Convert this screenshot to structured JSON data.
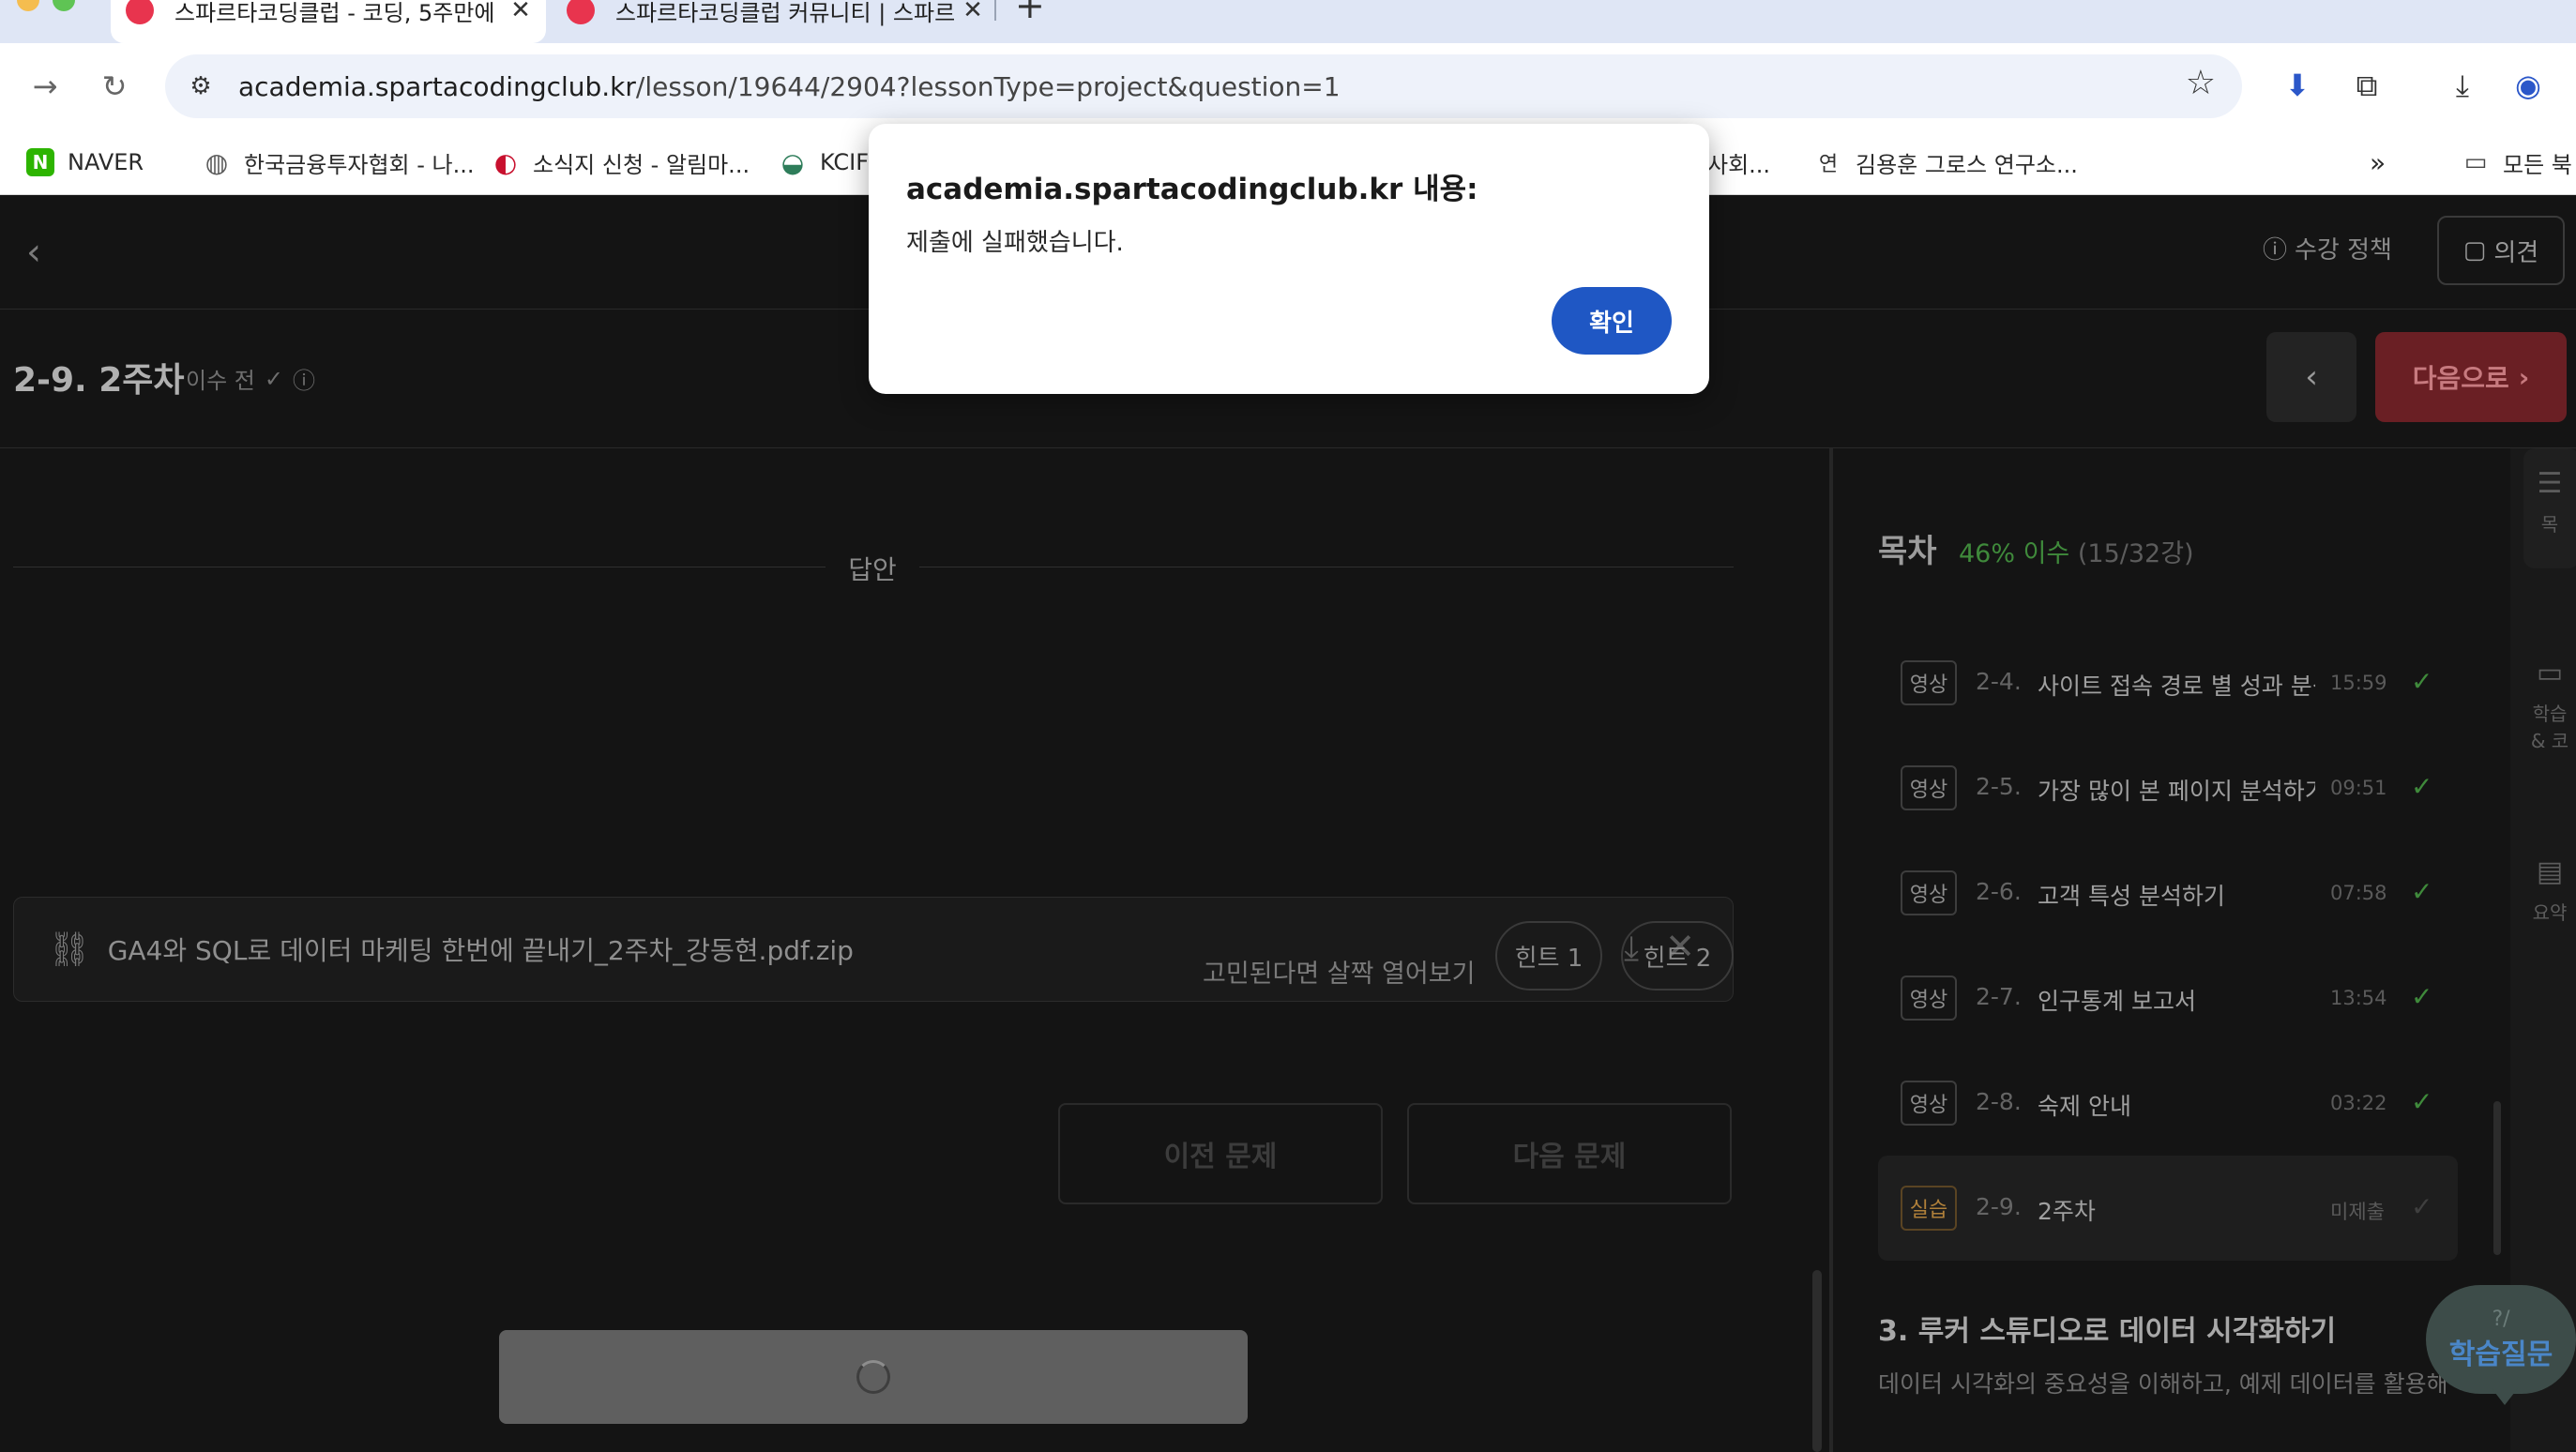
{
  "browser": {
    "tabs": [
      {
        "title": "스파르타코딩클럽 - 코딩, 5주만에",
        "close": "✕"
      },
      {
        "title": "스파르타코딩클럽 커뮤니티 | 스파르",
        "close": "✕"
      }
    ],
    "new_tab": "+",
    "url_host": "academia.spartacodingclub.kr",
    "url_path": "/lesson/19644/2904?lessonType=project&question=1",
    "bookmarks": [
      {
        "label": "NAVER",
        "icon": "naver-icon",
        "color": "#2db400",
        "glyph": "N"
      },
      {
        "label": "한국금융투자협회 - 나...",
        "icon": "globe-icon",
        "color": "#5a5a5a",
        "glyph": "◍"
      },
      {
        "label": "소식지 신청 - 알림마...",
        "icon": "korea-gov-icon",
        "color": "#c8102e",
        "glyph": "◐"
      },
      {
        "label": "KCIF",
        "icon": "kcif-icon",
        "color": "#2e7d5a",
        "glyph": "◒"
      },
      {
        "label": "사회...",
        "icon": "",
        "color": "",
        "glyph": ""
      },
      {
        "label": "김용훈 그로스 연구소...",
        "icon": "yeon-icon",
        "color": "#333333",
        "glyph": "연"
      }
    ],
    "bookmarks_more": "»",
    "all_bookmarks": "모든 북"
  },
  "header": {
    "policy": "수강 정책",
    "feedback": "의견"
  },
  "lesson": {
    "title": "2-9. 2주차",
    "status": "이수 전",
    "next": "다음으로"
  },
  "main": {
    "answer_label": "답안",
    "file_name": "GA4와 SQL로 데이터 마케팅 한번에 끝내기_2주차_강동현.pdf.zip",
    "hint_prompt": "고민된다면 살짝 열어보기",
    "hint1": "힌트 1",
    "hint2": "힌트 2",
    "prev_question": "이전 문제",
    "next_question": "다음 문제"
  },
  "toc": {
    "heading": "목차",
    "progress": "46% 이수",
    "count": "(15/32강)",
    "items": [
      {
        "tag": "영상",
        "num": "2-4.",
        "title": "사이트 접속 경로 별 성과 분석",
        "duration": "15:59",
        "check": "✓"
      },
      {
        "tag": "영상",
        "num": "2-5.",
        "title": "가장 많이 본 페이지 분석하기",
        "duration": "09:51",
        "check": "✓"
      },
      {
        "tag": "영상",
        "num": "2-6.",
        "title": "고객 특성 분석하기",
        "duration": "07:58",
        "check": "✓"
      },
      {
        "tag": "영상",
        "num": "2-7.",
        "title": "인구통계 보고서",
        "duration": "13:54",
        "check": "✓"
      },
      {
        "tag": "영상",
        "num": "2-8.",
        "title": "숙제 안내",
        "duration": "03:22",
        "check": "✓"
      },
      {
        "tag": "실습",
        "num": "2-9.",
        "title": "2주차",
        "duration": "미제출",
        "check": "✓"
      }
    ],
    "section_title": "3. 루커 스튜디오로 데이터 시각화하기",
    "section_desc": "데이터 시각화의 중요성을 이해하고, 예제 데이터를 활용해 루"
  },
  "rail": {
    "items": [
      "목",
      "학습\n& 코",
      "요약"
    ]
  },
  "qbubble": {
    "icon": "?/",
    "label": "학습질문"
  },
  "dialog": {
    "title": "academia.spartacodingclub.kr 내용:",
    "message": "제출에 실패했습니다.",
    "ok": "확인"
  },
  "colors": {
    "accent_blue": "#1f57c4",
    "progress_green": "#3f8a3b",
    "next_red": "#6a1f24",
    "practice_orange": "#b0803a"
  }
}
